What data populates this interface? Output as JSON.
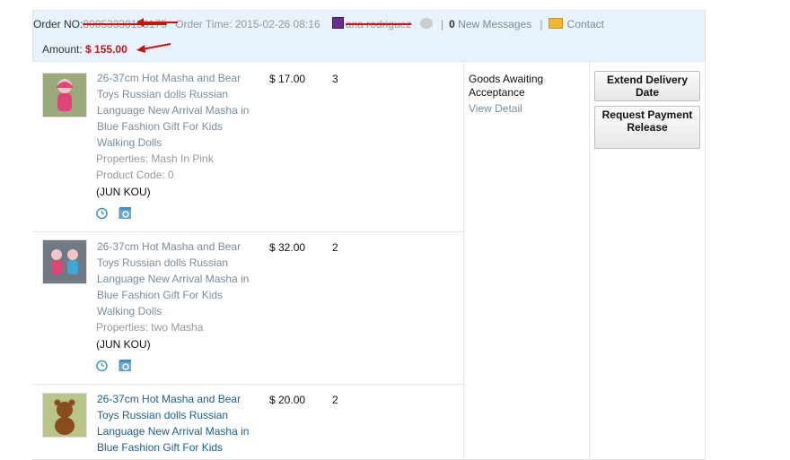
{
  "header": {
    "order_no_label": "Order NO:",
    "order_no_value": "80053338158175",
    "order_time_label": "Order Time:",
    "order_time_value": "2015-02-26 08:16",
    "buyer_name": "ana rodriguez",
    "messages_count": "0",
    "messages_label": "New Messages",
    "contact_label": "Contact",
    "amount_label": "Amount:",
    "amount_value": "$ 155.00"
  },
  "items": [
    {
      "title": "26-37cm Hot Masha and Bear Toys Russian dolls Russian Language New Arrival Masha in Blue Fashion Gift For Kids Walking Dolls",
      "price": "$ 17.00",
      "qty": "3",
      "properties": "Properties: Mash In Pink",
      "product_code": "Product Code: 0",
      "seller": "(JUN KOU)"
    },
    {
      "title": "26-37cm Hot Masha and Bear Toys Russian dolls Russian Language New Arrival Masha in Blue Fashion Gift For Kids Walking Dolls",
      "price": "$ 32.00",
      "qty": "2",
      "properties": "Properties: two Masha",
      "seller": "(JUN KOU)"
    },
    {
      "title": "26-37cm Hot Masha and Bear Toys Russian dolls Russian Language New Arrival Masha in Blue Fashion Gift For Kids",
      "price": "$ 20.00",
      "qty": "2"
    }
  ],
  "status": {
    "text": "Goods Awaiting Acceptance",
    "view_detail": "View Detail"
  },
  "actions": {
    "extend_delivery": "Extend Delivery Date",
    "request_payment": "Request Payment Release"
  },
  "icons": {
    "alarm": "alarm-clock-icon",
    "refresh": "refresh-icon",
    "mail": "mail-icon",
    "chat": "chat-icon"
  },
  "colors": {
    "header_bg": "#e8f2fb",
    "amount_red": "#c0181e",
    "link_gray_blue": "#7a8d9c"
  }
}
